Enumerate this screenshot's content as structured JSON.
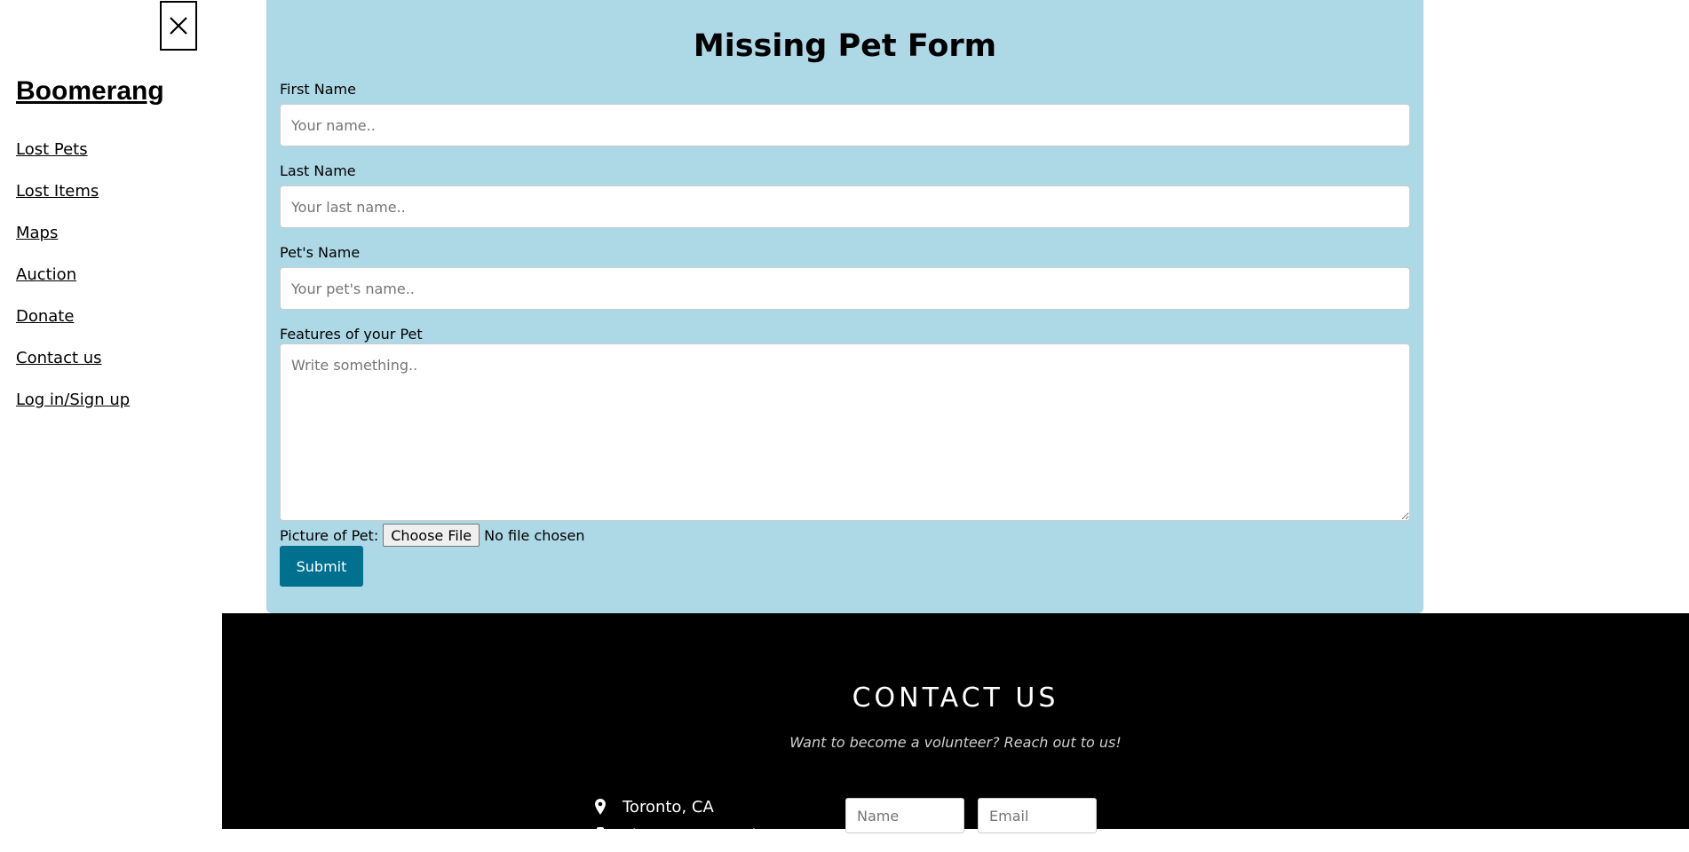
{
  "sidebar": {
    "brand": "Boomerang",
    "items": [
      {
        "label": "Lost Pets"
      },
      {
        "label": "Lost Items"
      },
      {
        "label": "Maps"
      },
      {
        "label": "Auction"
      },
      {
        "label": "Donate"
      },
      {
        "label": "Contact us"
      },
      {
        "label": "Log in/Sign up"
      }
    ]
  },
  "form": {
    "title": "Missing Pet Form",
    "first_name": {
      "label": "First Name",
      "placeholder": "Your name.."
    },
    "last_name": {
      "label": "Last Name",
      "placeholder": "Your last name.."
    },
    "pet_name": {
      "label": "Pet's Name",
      "placeholder": "Your pet's name.."
    },
    "features": {
      "label": "Features of your Pet",
      "placeholder": "Write something.."
    },
    "picture": {
      "label": "Picture of Pet:",
      "button": "Choose File",
      "status": "No file chosen"
    },
    "submit": "Submit"
  },
  "footer": {
    "title": "CONTACT US",
    "subtitle": "Want to become a volunteer? Reach out to us!",
    "location": "Toronto, CA",
    "phone": "Phone: *Insert phone",
    "name_placeholder": "Name",
    "email_placeholder": "Email"
  },
  "colors": {
    "panel": "#add8e6",
    "submit": "#00708f",
    "footer": "#000000"
  }
}
